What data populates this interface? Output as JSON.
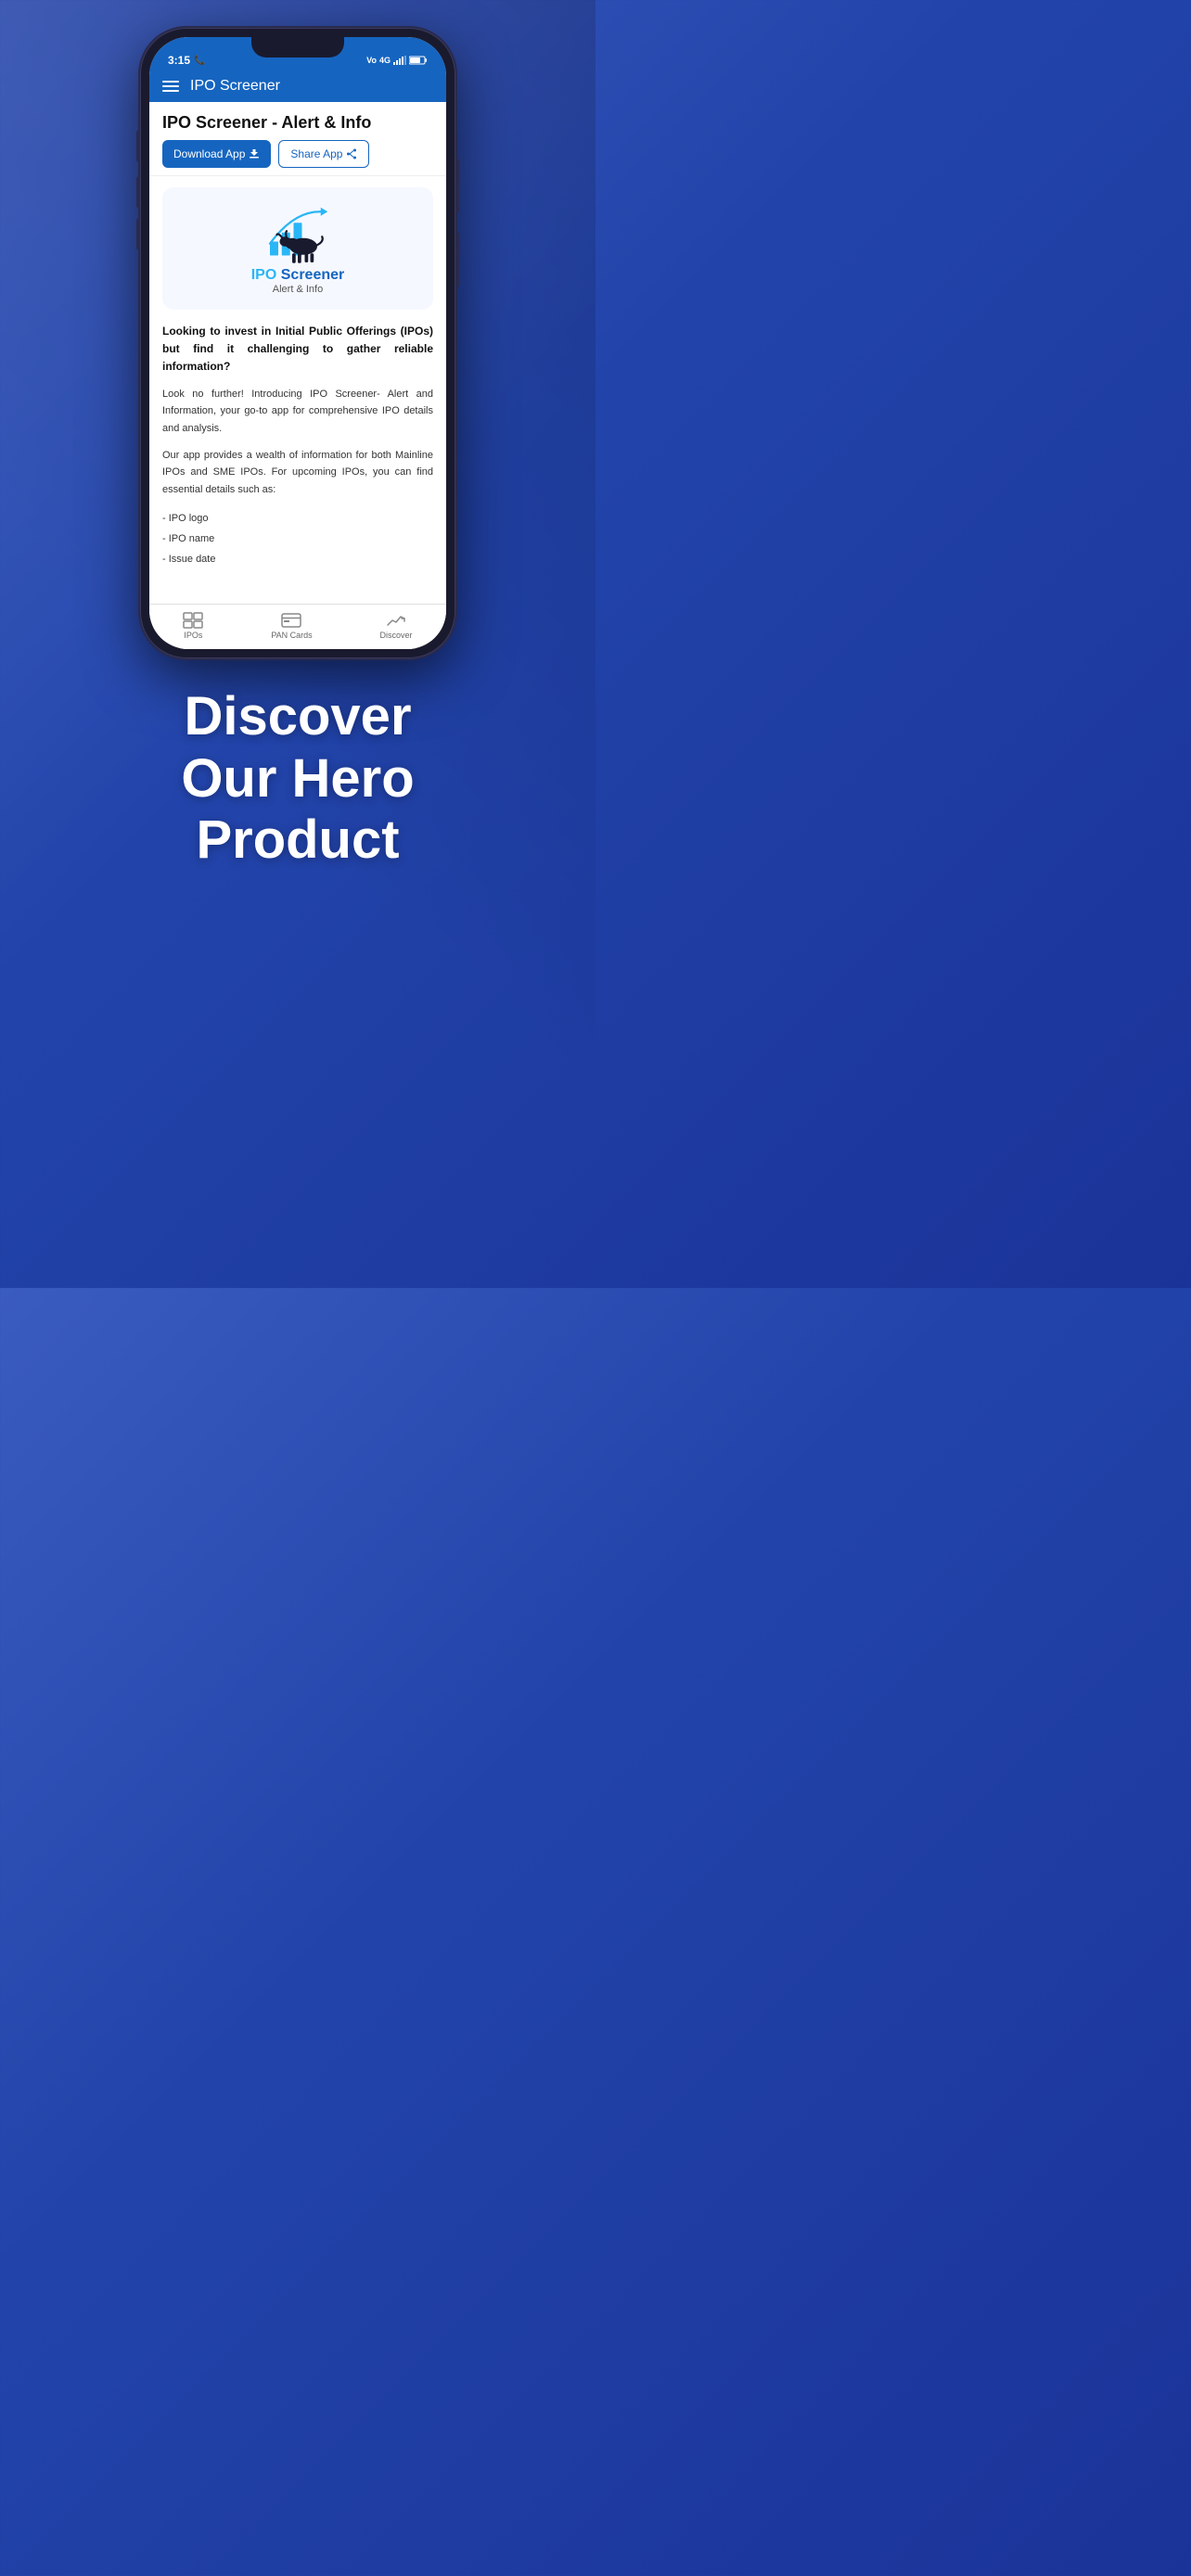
{
  "status_bar": {
    "time": "3:15",
    "phone_icon": "📞",
    "signal_icons": "Vo 4G",
    "battery": "54"
  },
  "app_bar": {
    "title": "IPO Screener",
    "menu_icon": "hamburger"
  },
  "page_header": {
    "title": "IPO Screener - Alert & Info",
    "download_label": "Download App",
    "share_label": "Share App"
  },
  "app_logo": {
    "title_colored": "IPO",
    "title_plain": " Screener",
    "subtitle": "Alert & Info"
  },
  "description": {
    "heading": "Looking to invest in Initial Public Offerings (IPOs) but find it challenging to gather reliable information?",
    "para1": "Look no further! Introducing IPO Screener- Alert and Information, your go-to app for comprehensive IPO details and analysis.",
    "para2": "Our app provides a wealth of information for both Mainline IPOs and SME IPOs. For upcoming IPOs, you can find essential details such as:",
    "list": [
      "- IPO logo",
      "- IPO name",
      "- Issue date"
    ]
  },
  "bottom_nav": {
    "items": [
      {
        "label": "IPOs",
        "icon": "grid"
      },
      {
        "label": "PAN Cards",
        "icon": "card"
      },
      {
        "label": "Discover",
        "icon": "chart"
      }
    ]
  },
  "hero_text": {
    "line1": "Discover",
    "line2": "Our Hero",
    "line3": "Product"
  }
}
